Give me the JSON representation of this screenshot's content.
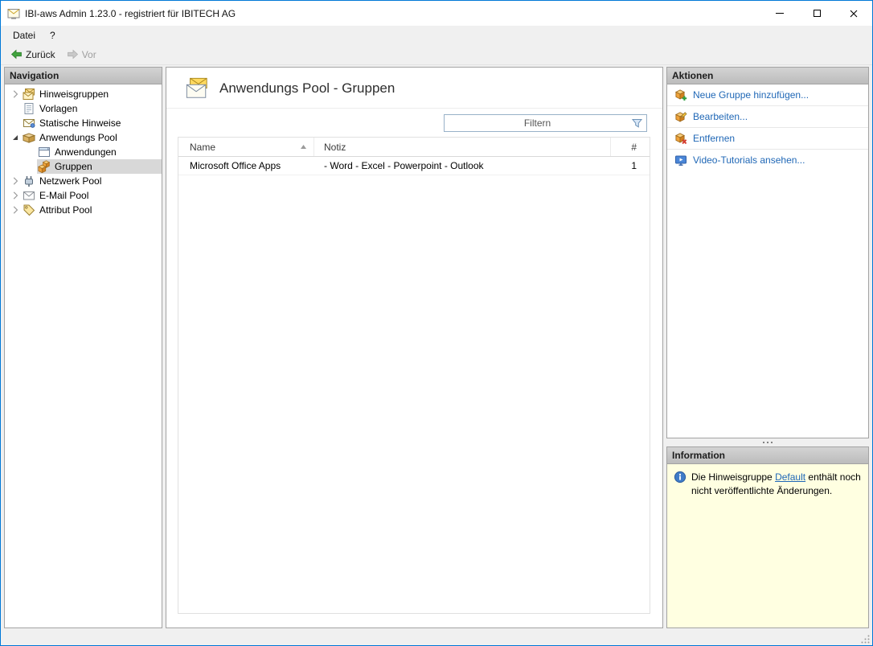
{
  "window": {
    "title": "IBI-aws Admin 1.23.0 - registriert für IBITECH AG",
    "controls": {
      "minimize": "minimize",
      "maximize": "maximize",
      "close": "close"
    }
  },
  "menubar": {
    "items": [
      {
        "label": "Datei"
      },
      {
        "label": "?"
      }
    ]
  },
  "toolbar": {
    "back_label": "Zurück",
    "forward_label": "Vor",
    "forward_enabled": false
  },
  "navigation": {
    "header": "Navigation",
    "items": [
      {
        "label": "Hinweisgruppen",
        "icon": "notice-groups-icon",
        "state": "collapsed",
        "level": 0,
        "selected": false
      },
      {
        "label": "Vorlagen",
        "icon": "templates-icon",
        "state": "none",
        "level": 0,
        "selected": false
      },
      {
        "label": "Statische Hinweise",
        "icon": "static-notices-icon",
        "state": "none",
        "level": 0,
        "selected": false
      },
      {
        "label": "Anwendungs Pool",
        "icon": "application-pool-icon",
        "state": "expanded",
        "level": 0,
        "selected": false
      },
      {
        "label": "Anwendungen",
        "icon": "applications-icon",
        "state": "none",
        "level": 1,
        "selected": false
      },
      {
        "label": "Gruppen",
        "icon": "groups-icon",
        "state": "none",
        "level": 1,
        "selected": true
      },
      {
        "label": "Netzwerk Pool",
        "icon": "network-pool-icon",
        "state": "collapsed",
        "level": 0,
        "selected": false
      },
      {
        "label": "E-Mail Pool",
        "icon": "email-pool-icon",
        "state": "collapsed",
        "level": 0,
        "selected": false
      },
      {
        "label": "Attribut Pool",
        "icon": "attribute-pool-icon",
        "state": "collapsed",
        "level": 0,
        "selected": false
      }
    ]
  },
  "main": {
    "icon": "groups-page-icon",
    "title": "Anwendungs Pool - Gruppen",
    "filter": {
      "placeholder": "Filtern",
      "value": "",
      "icon": "filter-funnel-icon"
    },
    "table": {
      "columns": [
        {
          "label": "Name",
          "sorted": "asc"
        },
        {
          "label": "Notiz",
          "sorted": "none"
        },
        {
          "label": "#",
          "sorted": "none"
        }
      ],
      "rows": [
        {
          "name": "Microsoft Office Apps",
          "notiz": "- Word - Excel - Powerpoint - Outlook",
          "count": "1"
        }
      ]
    }
  },
  "actions": {
    "header": "Aktionen",
    "items": [
      {
        "label": "Neue Gruppe hinzufügen...",
        "icon": "add-group-icon"
      },
      {
        "label": "Bearbeiten...",
        "icon": "edit-group-icon"
      },
      {
        "label": "Entfernen",
        "icon": "remove-group-icon"
      },
      {
        "label": "Video-Tutorials ansehen...",
        "icon": "video-tutorials-icon"
      }
    ]
  },
  "information": {
    "header": "Information",
    "icon": "info-icon",
    "text_before": "Die Hinweisgruppe ",
    "link_label": "Default",
    "text_after": " enthält noch nicht veröffentlichte Änderungen."
  },
  "colors": {
    "window_border": "#0078d7",
    "panel_header_bg": "#c6c6c6",
    "selection_bg": "#d8d8d8",
    "link_blue": "#1f67b6",
    "info_bg": "#ffffe1",
    "back_arrow_green": "#41a33e",
    "group_cube_orange": "#efa23a"
  }
}
